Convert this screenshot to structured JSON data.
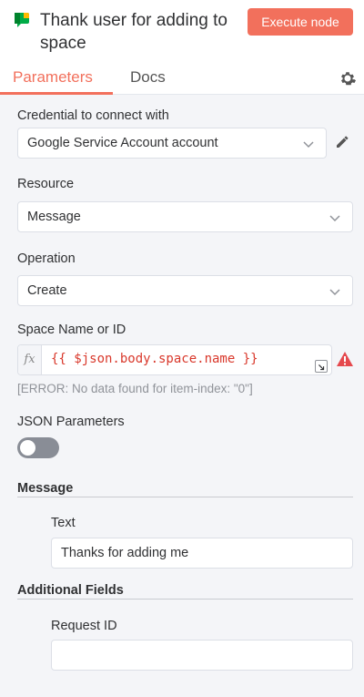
{
  "header": {
    "title": "Thank user for adding to space",
    "execute_label": "Execute node",
    "app_icon": "google-chat-icon"
  },
  "tabs": [
    {
      "label": "Parameters",
      "active": true
    },
    {
      "label": "Docs",
      "active": false
    }
  ],
  "credential": {
    "label": "Credential to connect with",
    "value": "Google Service Account account"
  },
  "resource": {
    "label": "Resource",
    "value": "Message"
  },
  "operation": {
    "label": "Operation",
    "value": "Create"
  },
  "space": {
    "label": "Space Name or ID",
    "fx": "fx",
    "expression": "{{ $json.body.space.name }}",
    "error": "[ERROR: No data found for item-index: \"0\"]"
  },
  "json_parameters": {
    "label": "JSON Parameters",
    "enabled": false
  },
  "message": {
    "section": "Message",
    "text_label": "Text",
    "text_value": "Thanks for adding me"
  },
  "additional": {
    "section": "Additional Fields",
    "request_id_label": "Request ID",
    "request_id_value": ""
  },
  "colors": {
    "accent": "#f2705c",
    "error_text": "#d9382b",
    "warning": "#e5484d",
    "toggle_off": "#898d96"
  }
}
